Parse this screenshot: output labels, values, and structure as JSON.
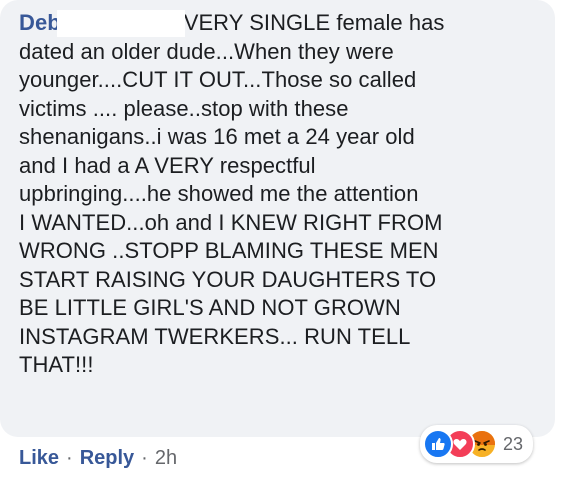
{
  "comment": {
    "author": "Deb",
    "first_line": "EVERY SINGLE female has",
    "body": "dated an older dude...When they were\nyounger....CUT IT OUT...Those so called\nvictims .... please..stop with these\nshenanigans..i was 16 met a 24 year old\nand I had a A VERY respectful\nupbringing....he showed me the attention\nI WANTED...oh and I KNEW RIGHT FROM\nWRONG ..STOPP BLAMING THESE MEN\nSTART RAISING YOUR DAUGHTERS TO\nBE LITTLE GIRL'S AND NOT GROWN\nINSTAGRAM TWERKERS... RUN TELL\nTHAT!!!"
  },
  "reactions": {
    "count": "23",
    "icons": [
      "like-icon",
      "love-icon",
      "angry-icon"
    ],
    "colors": {
      "like": "#1877f2",
      "love": "#f33e58",
      "angry": "#f7b125"
    }
  },
  "actions": {
    "like_label": "Like",
    "reply_label": "Reply",
    "separator": "·",
    "timestamp": "2h"
  }
}
